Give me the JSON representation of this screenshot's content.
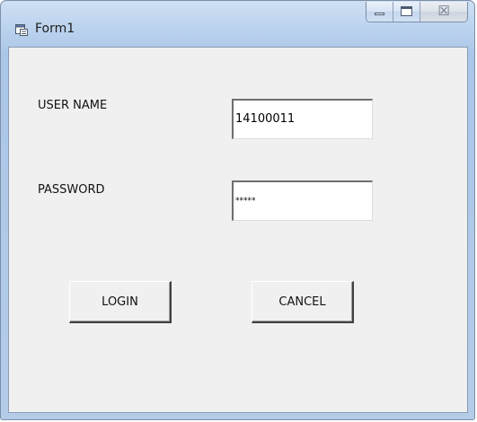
{
  "window": {
    "title": "Form1"
  },
  "form": {
    "username_label": "USER NAME",
    "username_value": "14100011",
    "password_label": "PASSWORD",
    "password_value": "*****",
    "login_label": "LOGIN",
    "cancel_label": "CANCEL"
  },
  "caption": {
    "close_glyph": "☒"
  },
  "icons": {
    "app": "form-app-icon",
    "minimize": "minimize-icon",
    "maximize": "maximize-icon",
    "close": "close-icon"
  }
}
